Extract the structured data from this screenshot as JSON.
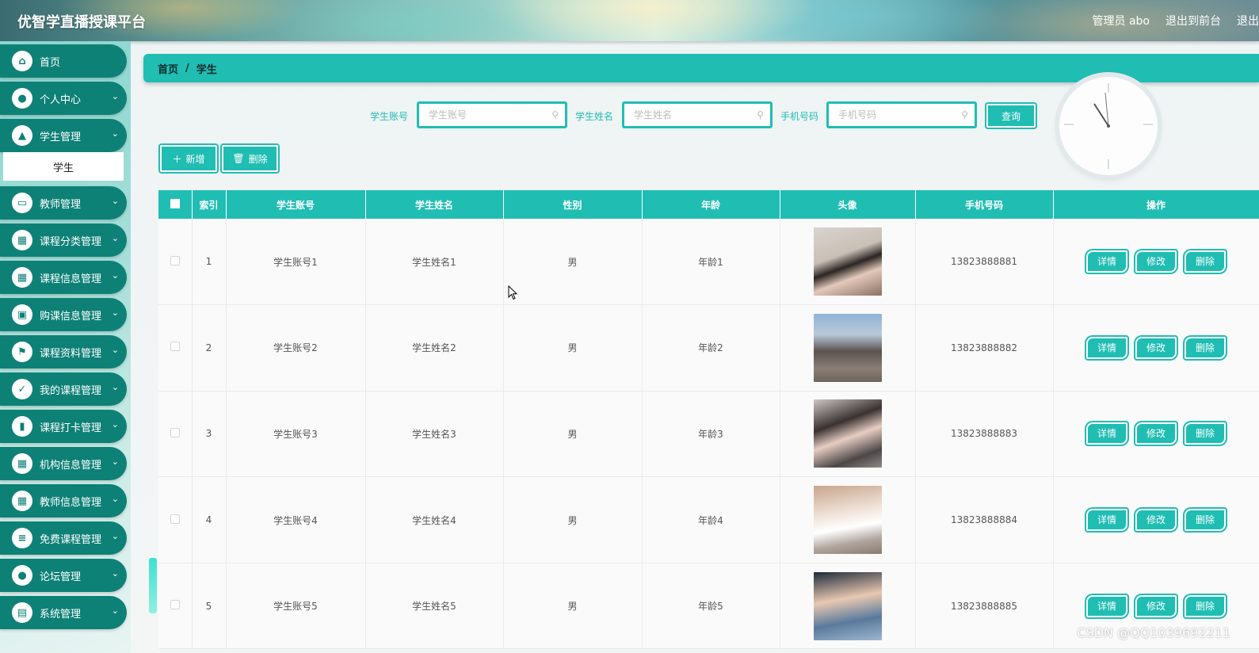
{
  "header": {
    "title": "优智学直播授课平台",
    "admin_label": "管理员 abo",
    "front_label": "退出到前台",
    "logout_label": "退出"
  },
  "sidebar": {
    "items": [
      {
        "label": "首页",
        "icon": "home-icon"
      },
      {
        "label": "个人中心",
        "icon": "user-icon"
      },
      {
        "label": "学生管理",
        "icon": "chart-icon"
      },
      {
        "label": "教师管理",
        "icon": "monitor-icon"
      },
      {
        "label": "课程分类管理",
        "icon": "grid-icon"
      },
      {
        "label": "课程信息管理",
        "icon": "grid-icon"
      },
      {
        "label": "购课信息管理",
        "icon": "briefcase-icon"
      },
      {
        "label": "课程资料管理",
        "icon": "flag-icon"
      },
      {
        "label": "我的课程管理",
        "icon": "clipboard-check-icon"
      },
      {
        "label": "课程打卡管理",
        "icon": "bar-chart-icon"
      },
      {
        "label": "机构信息管理",
        "icon": "grid-icon"
      },
      {
        "label": "教师信息管理",
        "icon": "grid-icon"
      },
      {
        "label": "免费课程管理",
        "icon": "list-icon"
      },
      {
        "label": "论坛管理",
        "icon": "user-icon"
      },
      {
        "label": "系统管理",
        "icon": "document-icon"
      }
    ],
    "sub_item": "学生"
  },
  "breadcrumb": {
    "home": "首页",
    "separator": "/",
    "current": "学生"
  },
  "search": {
    "account_label": "学生账号",
    "account_placeholder": "学生账号",
    "name_label": "学生姓名",
    "name_placeholder": "学生姓名",
    "phone_label": "手机号码",
    "phone_placeholder": "手机号码",
    "query_button": "查询"
  },
  "actions": {
    "add_label": "新增",
    "delete_label": "删除"
  },
  "table": {
    "columns": [
      "索引",
      "学生账号",
      "学生姓名",
      "性别",
      "年龄",
      "头像",
      "手机号码",
      "操作"
    ],
    "rows": [
      {
        "index": "1",
        "account": "学生账号1",
        "name": "学生姓名1",
        "gender": "男",
        "age": "年龄1",
        "phone": "13823888881"
      },
      {
        "index": "2",
        "account": "学生账号2",
        "name": "学生姓名2",
        "gender": "男",
        "age": "年龄2",
        "phone": "13823888882"
      },
      {
        "index": "3",
        "account": "学生账号3",
        "name": "学生姓名3",
        "gender": "男",
        "age": "年龄3",
        "phone": "13823888883"
      },
      {
        "index": "4",
        "account": "学生账号4",
        "name": "学生姓名4",
        "gender": "男",
        "age": "年龄4",
        "phone": "13823888884"
      },
      {
        "index": "5",
        "account": "学生账号5",
        "name": "学生姓名5",
        "gender": "男",
        "age": "年龄5",
        "phone": "13823888885"
      }
    ],
    "row_actions": {
      "detail": "详情",
      "edit": "修改",
      "delete": "删除"
    }
  },
  "watermark": "CSDN @QQ1039692211",
  "colors": {
    "accent": "#20bdb3",
    "sidebar": "#0e8177"
  }
}
